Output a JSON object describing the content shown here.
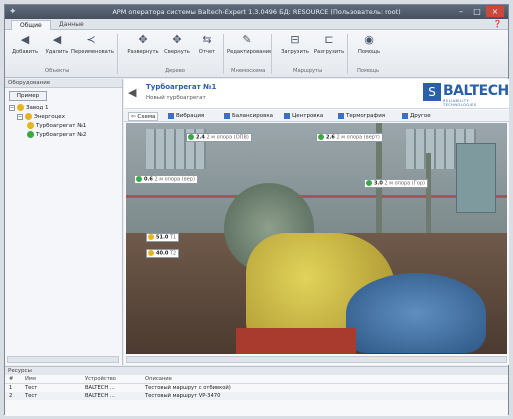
{
  "window": {
    "title": "АРМ оператора системы Baltech-Expert 1.3.0496 БД: RESOURCE (Пользователь: root)",
    "controls": [
      "–",
      "□",
      "×"
    ]
  },
  "tabs": [
    {
      "label": "Общие",
      "active": true
    },
    {
      "label": "Данные",
      "active": false
    }
  ],
  "ribbon": {
    "buttons": [
      {
        "label": "Добавить",
        "icon": "add-icon"
      },
      {
        "label": "Удалить",
        "icon": "delete-icon"
      },
      {
        "label": "Переименовать",
        "icon": "rename-icon"
      },
      {
        "label": "Развернуть",
        "icon": "expand-icon"
      },
      {
        "label": "Свернуть",
        "icon": "collapse-icon"
      },
      {
        "label": "Отчет",
        "icon": "report-icon"
      },
      {
        "label": "Редактирование",
        "icon": "edit-icon"
      },
      {
        "label": "Загрузить",
        "icon": "upload-icon"
      },
      {
        "label": "Разгрузить",
        "icon": "download-icon"
      },
      {
        "label": "Помощь",
        "icon": "help-icon"
      }
    ],
    "groups": [
      "Объекты",
      "Дерево",
      "Мнемосхема",
      "Маршруты",
      "Помощь"
    ]
  },
  "tree_panel": {
    "header": "Оборудование",
    "button": "Пример",
    "nodes": [
      {
        "label": "Завод 1",
        "level": 0,
        "color": "#e6b422"
      },
      {
        "label": "Энергоцех",
        "level": 1,
        "color": "#e6b422"
      },
      {
        "label": "Турбоагрегат №1",
        "level": 2,
        "color": "#e6b422"
      },
      {
        "label": "Турбоагрегат №2",
        "level": 2,
        "color": "#3aa845"
      }
    ]
  },
  "machine": {
    "name": "Турбоагрегат №1",
    "route": "Новый турбоагрегат"
  },
  "logo": {
    "text": "BALTECH",
    "subtitle": "RELIABILITY TECHNOLOGIES"
  },
  "main_tabs": [
    "Схема",
    "Вибрация",
    "Балансировка",
    "Центровка",
    "Термография",
    "Другое"
  ],
  "tags": [
    {
      "value": "2.4",
      "unit": "2 м опора (ОПВ)",
      "color": "#3aa845"
    },
    {
      "value": "2.6",
      "unit": "2 м опора (верт)",
      "color": "#3aa845"
    },
    {
      "value": "0.6",
      "unit": "2 м опора (вер)",
      "color": "#3aa845"
    },
    {
      "value": "3.0",
      "unit": "2 м опора (Гор)",
      "color": "#3aa845"
    },
    {
      "value": "51.0",
      "unit": "T1",
      "color": "#e6b422"
    },
    {
      "value": "40.0",
      "unit": "T2",
      "color": "#e6b422"
    }
  ],
  "log_panel": {
    "header": "Ресурсы",
    "columns": [
      "#",
      "Имя",
      "Устройство",
      "Описание"
    ],
    "rows": [
      {
        "num": "1",
        "name": "Тест",
        "device": "BALTECH ...",
        "desc": "Тестовый маршрут с отбивкой)"
      },
      {
        "num": "2",
        "name": "Тест",
        "device": "BALTECH ...",
        "desc": "Тестовый маршрут VP-3470"
      }
    ]
  }
}
